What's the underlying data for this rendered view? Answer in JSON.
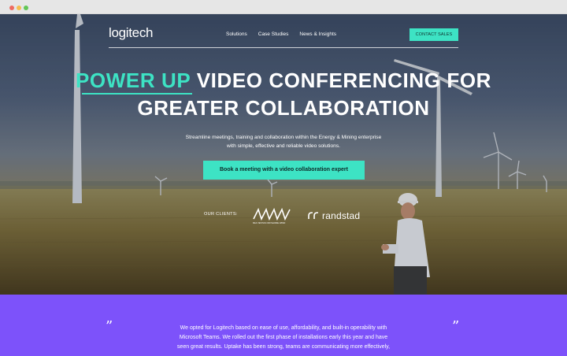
{
  "brand": {
    "logo_text": "logitech",
    "accent_color": "#3de3c4",
    "testimonial_bg": "#7d52fa"
  },
  "nav": {
    "items": [
      "Solutions",
      "Case Studies",
      "News & Insights"
    ],
    "contact_label": "CONTACT SALES"
  },
  "hero": {
    "headline_accent": "POWER UP",
    "headline_line1_rest": " VIDEO CONFERENCING FOR",
    "headline_line2": "GREATER COLLABORATION",
    "subtext_line1": "Streamline meetings, training and collaboration within the Energy & Mining enterprise",
    "subtext_line2": "with simple, effective and reliable video solutions.",
    "cta_label": "Book a meeting with a video collaboration expert"
  },
  "clients": {
    "label": "OUR CLIENTS:",
    "logos": [
      "vestas-logo",
      "randstad-logo"
    ],
    "vestas_caption": "MHI VESTAS OFFSHORE WIND",
    "randstad_text": "randstad"
  },
  "testimonial": {
    "open_quote": "”",
    "close_quote": "”",
    "line1": "We opted for Logitech based on ease of use, affordability, and built-in operability with",
    "line2": "Microsoft Teams. We rolled out the first phase of installations early this year and have",
    "line3": "seen great results. Uptake has been strong, teams are communicating more effectively,"
  }
}
